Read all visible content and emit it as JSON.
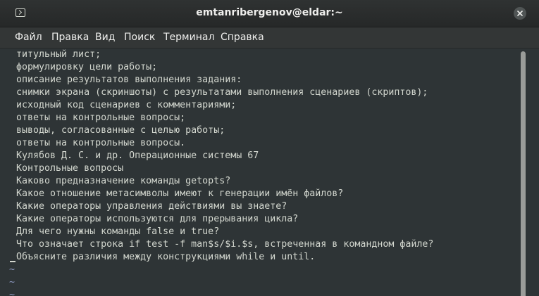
{
  "window": {
    "title": "emtanribergenov@eldar:~",
    "terminal_icon": "terminal-icon",
    "close_icon": "close-icon"
  },
  "menu": [
    "Файл",
    "Правка",
    "Вид",
    "Поиск",
    "Терминал",
    "Справка"
  ],
  "terminal": {
    "lines": [
      "титульный лист;",
      "формулировку цели работы;",
      "описание результатов выполнения задания:",
      "снимки экрана (скриншоты) с результатами выполнения сценариев (скриптов);",
      "исходный код сценариев с комментариями;",
      "ответы на контрольные вопросы;",
      "выводы, согласованные с целью работы;",
      "ответы на контрольные вопросы.",
      "Кулябов Д. С. и др. Операционные системы 67",
      "Контрольные вопросы",
      "Каково предназначение команды getopts?",
      "Какое отношение метасимволы имеют к генерации имён файлов?",
      "Какие операторы управления действиями вы знаете?",
      "Какие операторы используются для прерывания цикла?",
      "Для чего нужны команды false и true?",
      "Что означает строка if test -f man$s/$i.$s, встреченная в командном файле?",
      "Объясните различия между конструкциями while и until."
    ],
    "empty_line_marker": "~",
    "empty_lines": 3
  },
  "colors": {
    "background": "#2e3436",
    "text": "#d3d7cf",
    "tilde": "#8f9bc4"
  }
}
